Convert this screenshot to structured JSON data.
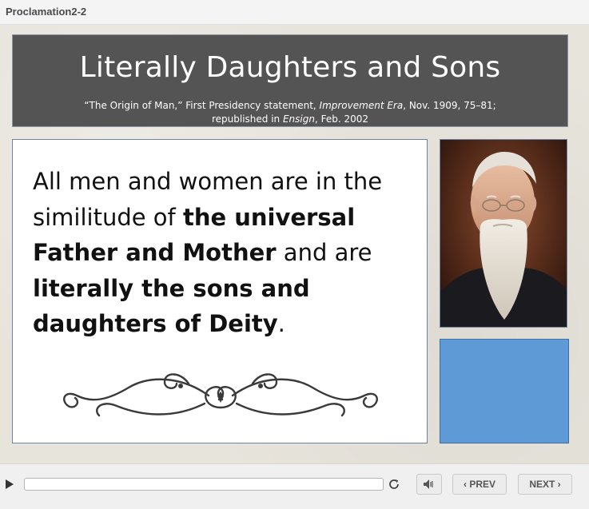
{
  "window": {
    "title": "Proclamation2-2"
  },
  "slide": {
    "title": "Literally Daughters and Sons",
    "citation": {
      "part1": "“The Origin of Man,” First Presidency statement, ",
      "part2": "Improvement Era",
      "part3": ", Nov. 1909, 75–81;",
      "part4": "republished in ",
      "part5": "Ensign",
      "part6": ", Feb. 2002"
    },
    "quote": {
      "t1": "All men and women are in the similitude of ",
      "b1": "the universal Father and Mother",
      "t2": " and are ",
      "b2": "literally the sons and daughters of Deity",
      "t3": "."
    },
    "portrait_alt": "Portrait of an elderly bearded man",
    "accent_color": "#5e9bd6"
  },
  "player": {
    "progress": 0.0,
    "prev_label": "PREV",
    "next_label": "NEXT"
  }
}
